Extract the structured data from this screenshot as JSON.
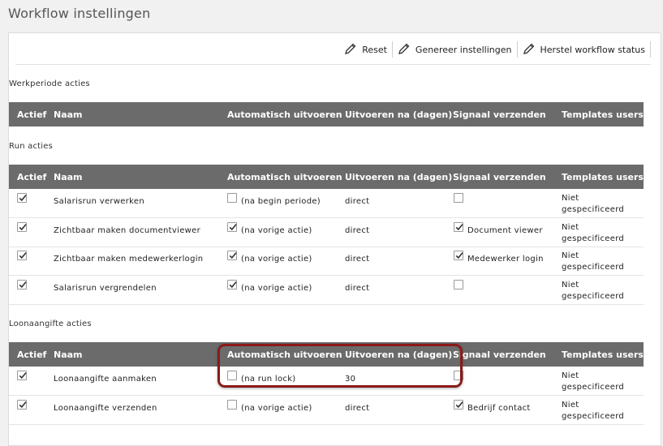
{
  "page_title": "Workflow instellingen",
  "toolbar": {
    "reset_label": "Reset",
    "genereer_label": "Genereer instellingen",
    "herstel_label": "Herstel workflow status"
  },
  "columns": {
    "actief": "Actief",
    "naam": "Naam",
    "automatisch": "Automatisch uitvoeren",
    "uitvoeren_na": "Uitvoeren na (dagen)",
    "signaal": "Signaal verzenden",
    "templates": "Templates users"
  },
  "sections": {
    "werkperiode": {
      "title": "Werkperiode acties",
      "rows": []
    },
    "run": {
      "title": "Run acties",
      "rows": [
        {
          "actief": true,
          "naam": "Salarisrun verwerken",
          "auto_checked": false,
          "auto_label": "(na begin periode)",
          "uitvoeren_na": "direct",
          "signaal_checked": false,
          "signaal_label": "",
          "templates": "Niet gespecificeerd"
        },
        {
          "actief": true,
          "naam": "Zichtbaar maken documentviewer",
          "auto_checked": true,
          "auto_label": "(na vorige actie)",
          "uitvoeren_na": "direct",
          "signaal_checked": true,
          "signaal_label": "Document viewer",
          "templates": "Niet gespecificeerd"
        },
        {
          "actief": true,
          "naam": "Zichtbaar maken medewerkerlogin",
          "auto_checked": true,
          "auto_label": "(na vorige actie)",
          "uitvoeren_na": "direct",
          "signaal_checked": true,
          "signaal_label": "Medewerker login",
          "templates": "Niet gespecificeerd"
        },
        {
          "actief": true,
          "naam": "Salarisrun vergrendelen",
          "auto_checked": true,
          "auto_label": "(na vorige actie)",
          "uitvoeren_na": "direct",
          "signaal_checked": false,
          "signaal_label": "",
          "templates": "Niet gespecificeerd"
        }
      ]
    },
    "loonaangifte": {
      "title": "Loonaangifte acties",
      "rows": [
        {
          "actief": true,
          "naam": "Loonaangifte aanmaken",
          "auto_checked": false,
          "auto_label": "(na run lock)",
          "uitvoeren_na": "30",
          "signaal_checked": false,
          "signaal_label": "",
          "templates": "Niet gespecificeerd"
        },
        {
          "actief": true,
          "naam": "Loonaangifte verzenden",
          "auto_checked": false,
          "auto_label": "(na vorige actie)",
          "uitvoeren_na": "direct",
          "signaal_checked": true,
          "signaal_label": "Bedrijf contact",
          "templates": "Niet gespecificeerd"
        }
      ]
    }
  },
  "colors": {
    "header_bg": "#6b6b6b",
    "highlight": "#8b1a1a"
  }
}
